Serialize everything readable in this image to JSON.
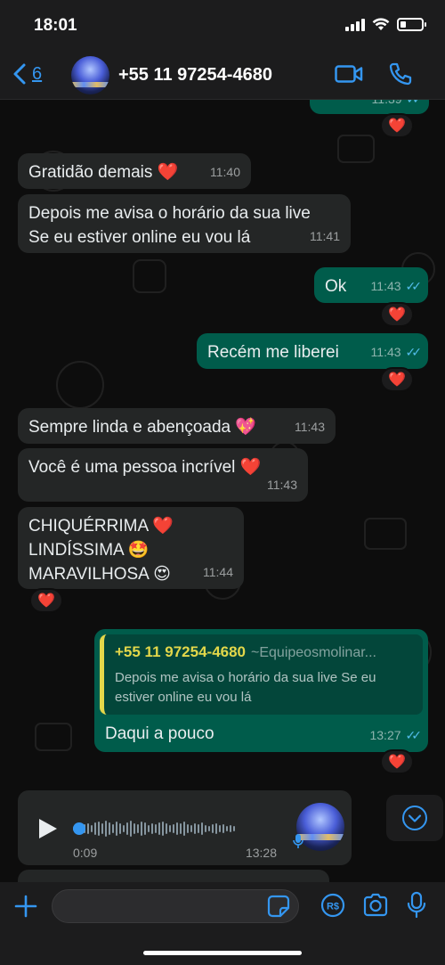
{
  "status": {
    "time": "18:01",
    "battery_level": 0.25
  },
  "header": {
    "back_count": "6",
    "contact": "+55 11 97254-4680"
  },
  "colors": {
    "accent": "#3496f0",
    "outgoing": "#005c4b",
    "incoming": "#242626",
    "quote_author": "#e3d74a"
  },
  "messages": {
    "m0": {
      "time": "11:39"
    },
    "m1": {
      "text": "Gratidão demais ❤️",
      "time": "11:40"
    },
    "m2": {
      "line1": "Depois me avisa o horário da sua live",
      "line2": "Se eu estiver online eu vou lá",
      "time": "11:41"
    },
    "m3": {
      "text": "Ok",
      "time": "11:43"
    },
    "m4": {
      "text": "Recém me liberei",
      "time": "11:43"
    },
    "m5": {
      "text": "Sempre linda e abençoada 💖",
      "time": "11:43"
    },
    "m6": {
      "text": "Você é uma pessoa incrível ❤️",
      "time": "11:43"
    },
    "m7": {
      "line1": "CHIQUÉRRIMA ❤️",
      "line2": "LINDÍSSIMA 🤩",
      "line3": "MARAVILHOSA 😍",
      "time": "11:44"
    },
    "m8": {
      "quote_author": "+55 11 97254-4680",
      "quote_nick": "~Equipeosmolinar...",
      "quote_text": "Depois me avisa o horário da sua live Se eu estiver online eu vou lá",
      "text": "Daqui a pouco",
      "time": "13:27"
    },
    "voice": {
      "duration": "0:09",
      "time": "13:28"
    }
  },
  "reaction": "❤️"
}
